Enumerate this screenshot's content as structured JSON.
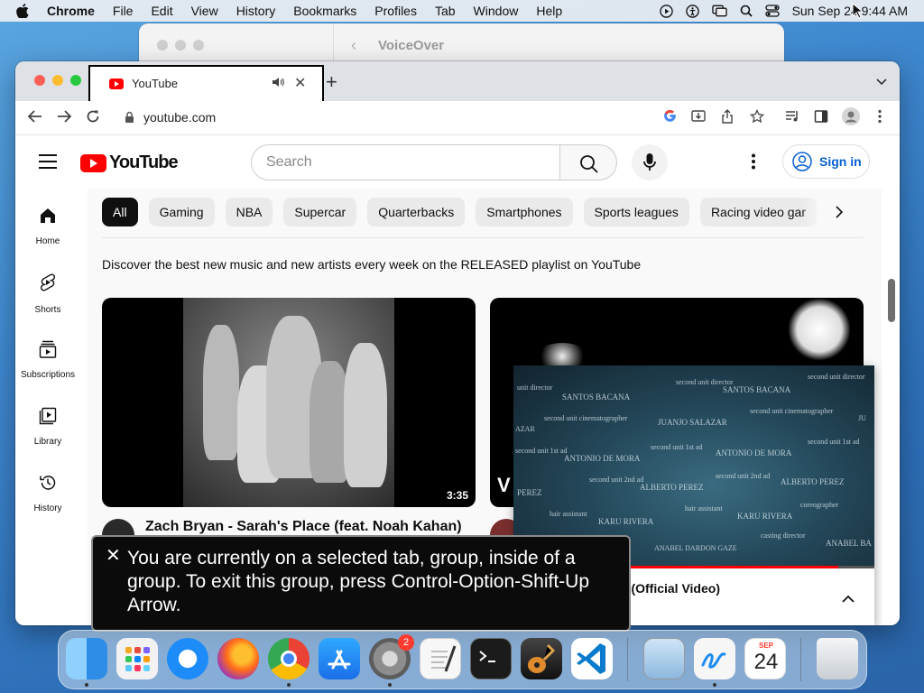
{
  "menubar": {
    "app_name": "Chrome",
    "menus": [
      "File",
      "Edit",
      "View",
      "History",
      "Bookmarks",
      "Profiles",
      "Tab",
      "Window",
      "Help"
    ],
    "datetime": "Sun Sep 24  9:44 AM"
  },
  "voiceover_window": {
    "title": "VoiceOver"
  },
  "browser": {
    "tab_title": "YouTube",
    "url": "youtube.com"
  },
  "youtube": {
    "logo_text": "YouTube",
    "search_placeholder": "Search",
    "sign_in": "Sign in",
    "sidebar": [
      {
        "label": "Home",
        "icon": "home-icon"
      },
      {
        "label": "Shorts",
        "icon": "shorts-icon"
      },
      {
        "label": "Subscriptions",
        "icon": "subscriptions-icon"
      },
      {
        "label": "Library",
        "icon": "library-icon"
      },
      {
        "label": "History",
        "icon": "history-icon"
      }
    ],
    "chips": [
      "All",
      "Gaming",
      "NBA",
      "Supercar",
      "Quarterbacks",
      "Smartphones",
      "Sports leagues",
      "Racing video gar"
    ],
    "promo_text": "Discover the best new music and new artists every week on the RELEASED playlist on YouTube",
    "videos": [
      {
        "title": "Zach Bryan - Sarah's Place (feat. Noah Kahan)",
        "duration": "3:35"
      }
    ],
    "miniplayer": {
      "title": "u (Official Video)",
      "progress": 0.9,
      "credits": [
        "unit director",
        "SANTOS BACANA",
        "second unit director",
        "SANTOS BACANA",
        "second unit director",
        "second unit cinematographer",
        "JUANJO SALAZAR",
        "second unit cinematographer",
        "JU",
        "AZAR",
        "second unit 1st ad",
        "ANTONIO DE MORA",
        "second unit 1st ad",
        "ANTONIO DE MORA",
        "second unit 1st ad",
        "second unit 2nd ad",
        "ALBERTO PEREZ",
        "second unit 2nd ad",
        "ALBERTO PEREZ",
        "PEREZ",
        "hair assistant",
        "KARU RIVERA",
        "hair assistant",
        "KARU RIVERA",
        "coreographer",
        "ANABEL DARDON GAZE",
        "casting director",
        "ANABEL BA"
      ]
    }
  },
  "voiceover_caption": {
    "text": "You are currently on a selected tab, group, inside of a group.  To exit this group, press Control-Option-Shift-Up Arrow."
  },
  "dock": {
    "apps": [
      "Finder",
      "Launchpad",
      "Safari",
      "Firefox",
      "Chrome",
      "App Store",
      "System Settings",
      "TextEdit",
      "Terminal",
      "GarageBand",
      "Visual Studio Code",
      "Preview",
      "Freeform",
      "Calendar",
      "Trash"
    ],
    "settings_badge": "2",
    "calendar_month": "SEP",
    "calendar_day": "24"
  }
}
